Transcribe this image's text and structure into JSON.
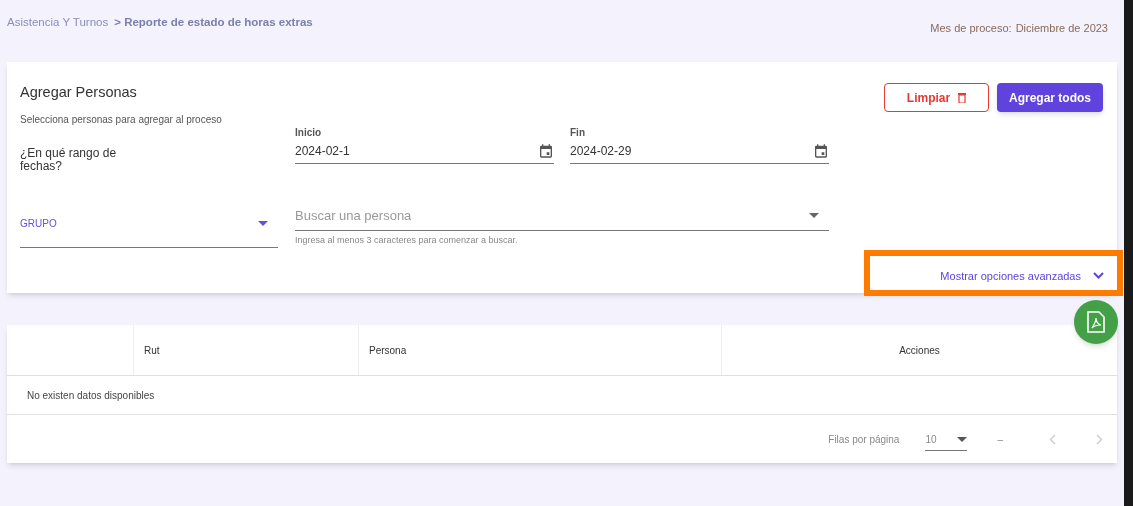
{
  "breadcrumb": {
    "parent": "Asistencia Y Turnos",
    "current": "> Reporte de estado de horas extras"
  },
  "process_month": {
    "label": "Mes de proceso:",
    "value": "Diciembre de 2023"
  },
  "card": {
    "title": "Agregar Personas",
    "subtitle": "Selecciona personas para agregar al proceso",
    "buttons": [
      {
        "kind": "outline",
        "label": "Limpiar"
      },
      {
        "kind": "filled",
        "label": "Agregar todos"
      }
    ],
    "range_label": "¿En qué rango de fechas?",
    "dates": [
      {
        "label": "Inicio",
        "value": "2024-02-1"
      },
      {
        "label": "Fin",
        "value": "2024-02-29"
      }
    ],
    "group_select": {
      "value": "GRUPO"
    },
    "person_search": {
      "placeholder": "Buscar una persona",
      "hint": "Ingresa al menos 3 caracteres para comenzar a buscar."
    },
    "advanced_toggle": {
      "label": "Mostrar opciones avanzadas",
      "highlighted": true
    }
  },
  "table": {
    "columns": [
      "Rut",
      "Persona",
      "Acciones"
    ],
    "empty_text": "No existen datos disponibles",
    "footer": {
      "rows_per_page_label": "Filas por página",
      "rows_per_page": "10",
      "range": "–"
    }
  }
}
